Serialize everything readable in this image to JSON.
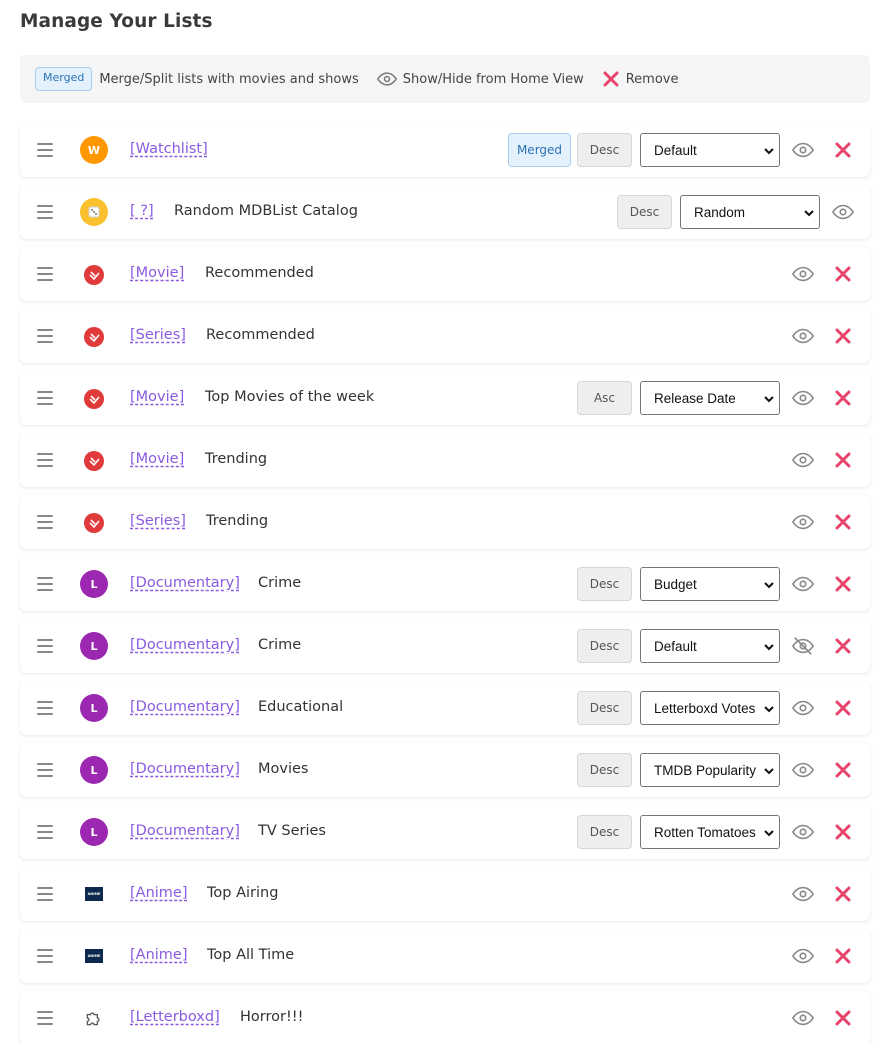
{
  "page": {
    "title": "Manage Your Lists"
  },
  "legend": {
    "merged_badge": "Merged",
    "merge_text": "Merge/Split lists with movies and shows",
    "show_hide_text": "Show/Hide from Home View",
    "remove_text": "Remove"
  },
  "colors": {
    "accent_purple": "#8a5ae0",
    "remove_red": "#e8436a",
    "merged_blue": "#2a72b5"
  },
  "rows": [
    {
      "avatar_letter": "W",
      "tag": "[Watchlist]",
      "name": "",
      "merged": "Merged",
      "order": "Desc",
      "sort": "Default",
      "visible": true
    },
    {
      "avatar_letter": "",
      "tag": "[ ?]",
      "name": "Random MDBList Catalog",
      "order": "Desc",
      "sort": "Random",
      "visible": true
    },
    {
      "tag": "[Movie]",
      "name": "Recommended",
      "visible": true
    },
    {
      "tag": "[Series]",
      "name": "Recommended",
      "visible": true
    },
    {
      "tag": "[Movie]",
      "name": "Top Movies of the week",
      "order": "Asc",
      "sort": "Release Date",
      "visible": true
    },
    {
      "tag": "[Movie]",
      "name": "Trending",
      "visible": true
    },
    {
      "tag": "[Series]",
      "name": "Trending",
      "visible": true
    },
    {
      "avatar_letter": "L",
      "tag": "[Documentary]",
      "name": "Crime",
      "order": "Desc",
      "sort": "Budget",
      "visible": true
    },
    {
      "avatar_letter": "L",
      "tag": "[Documentary]",
      "name": "Crime",
      "order": "Desc",
      "sort": "Default",
      "visible": false
    },
    {
      "avatar_letter": "L",
      "tag": "[Documentary]",
      "name": "Educational",
      "order": "Desc",
      "sort": "Letterboxd Votes",
      "visible": true
    },
    {
      "avatar_letter": "L",
      "tag": "[Documentary]",
      "name": "Movies",
      "order": "Desc",
      "sort": "TMDB Popularity",
      "visible": true
    },
    {
      "avatar_letter": "L",
      "tag": "[Documentary]",
      "name": "TV Series",
      "order": "Desc",
      "sort": "Rotten Tomatoes",
      "visible": true
    },
    {
      "tag": "[Anime]",
      "name": "Top Airing",
      "visible": true
    },
    {
      "tag": "[Anime]",
      "name": "Top All Time",
      "visible": true
    },
    {
      "tag": "[Letterboxd]",
      "name": "Horror!!!",
      "visible": true
    }
  ]
}
